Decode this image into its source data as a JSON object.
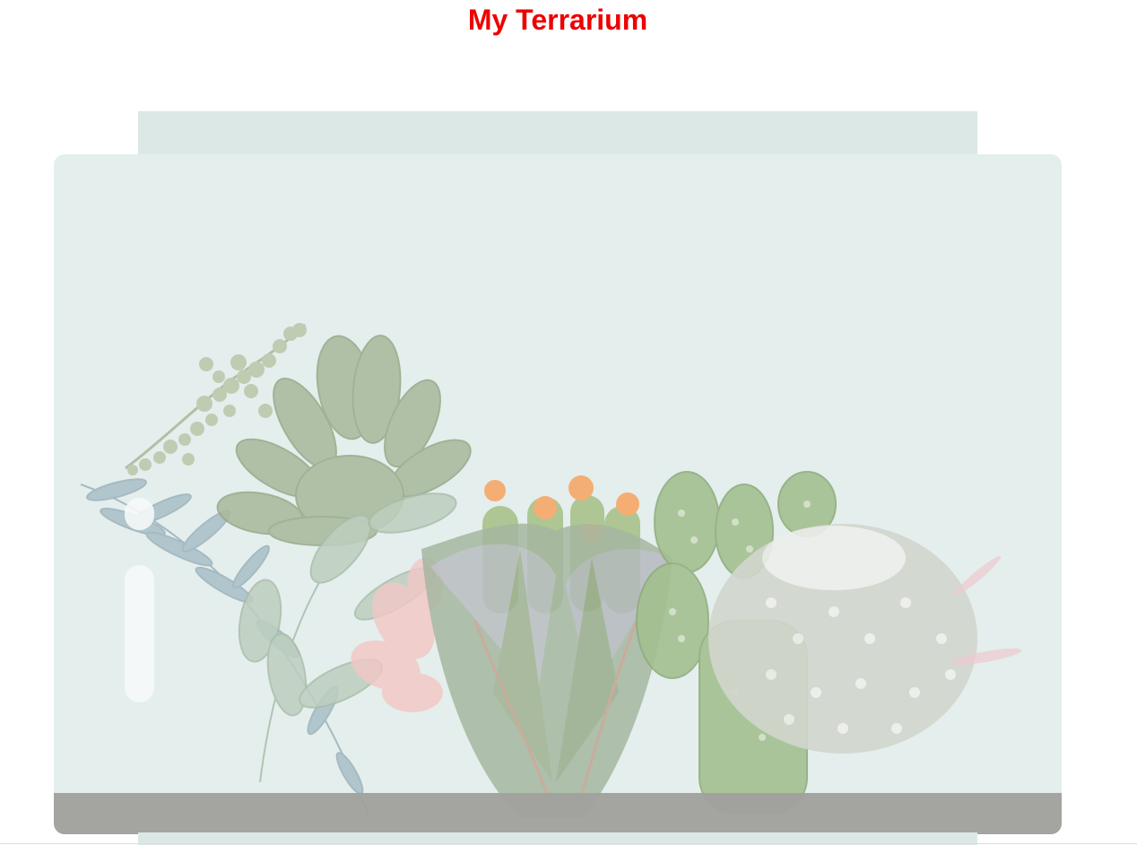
{
  "page": {
    "title": "My Terrarium"
  },
  "colors": {
    "title": "#ee0000",
    "jar_glass": "#e4eeed",
    "jar_top": "#dce8e6",
    "dirt": "#a1a19e",
    "glossy": "#f5f8f8"
  },
  "plants": [
    {
      "name": "string-of-pearls-plant"
    },
    {
      "name": "blue-fern-plant"
    },
    {
      "name": "green-succulent-rosette-plant"
    },
    {
      "name": "leafy-branch-plant"
    },
    {
      "name": "pink-flower-plant"
    },
    {
      "name": "orange-flowered-cactus-plant"
    },
    {
      "name": "silver-aloe-succulent-plant"
    },
    {
      "name": "prickly-pear-cactus-plant"
    },
    {
      "name": "white-ball-cactus-plant"
    }
  ]
}
